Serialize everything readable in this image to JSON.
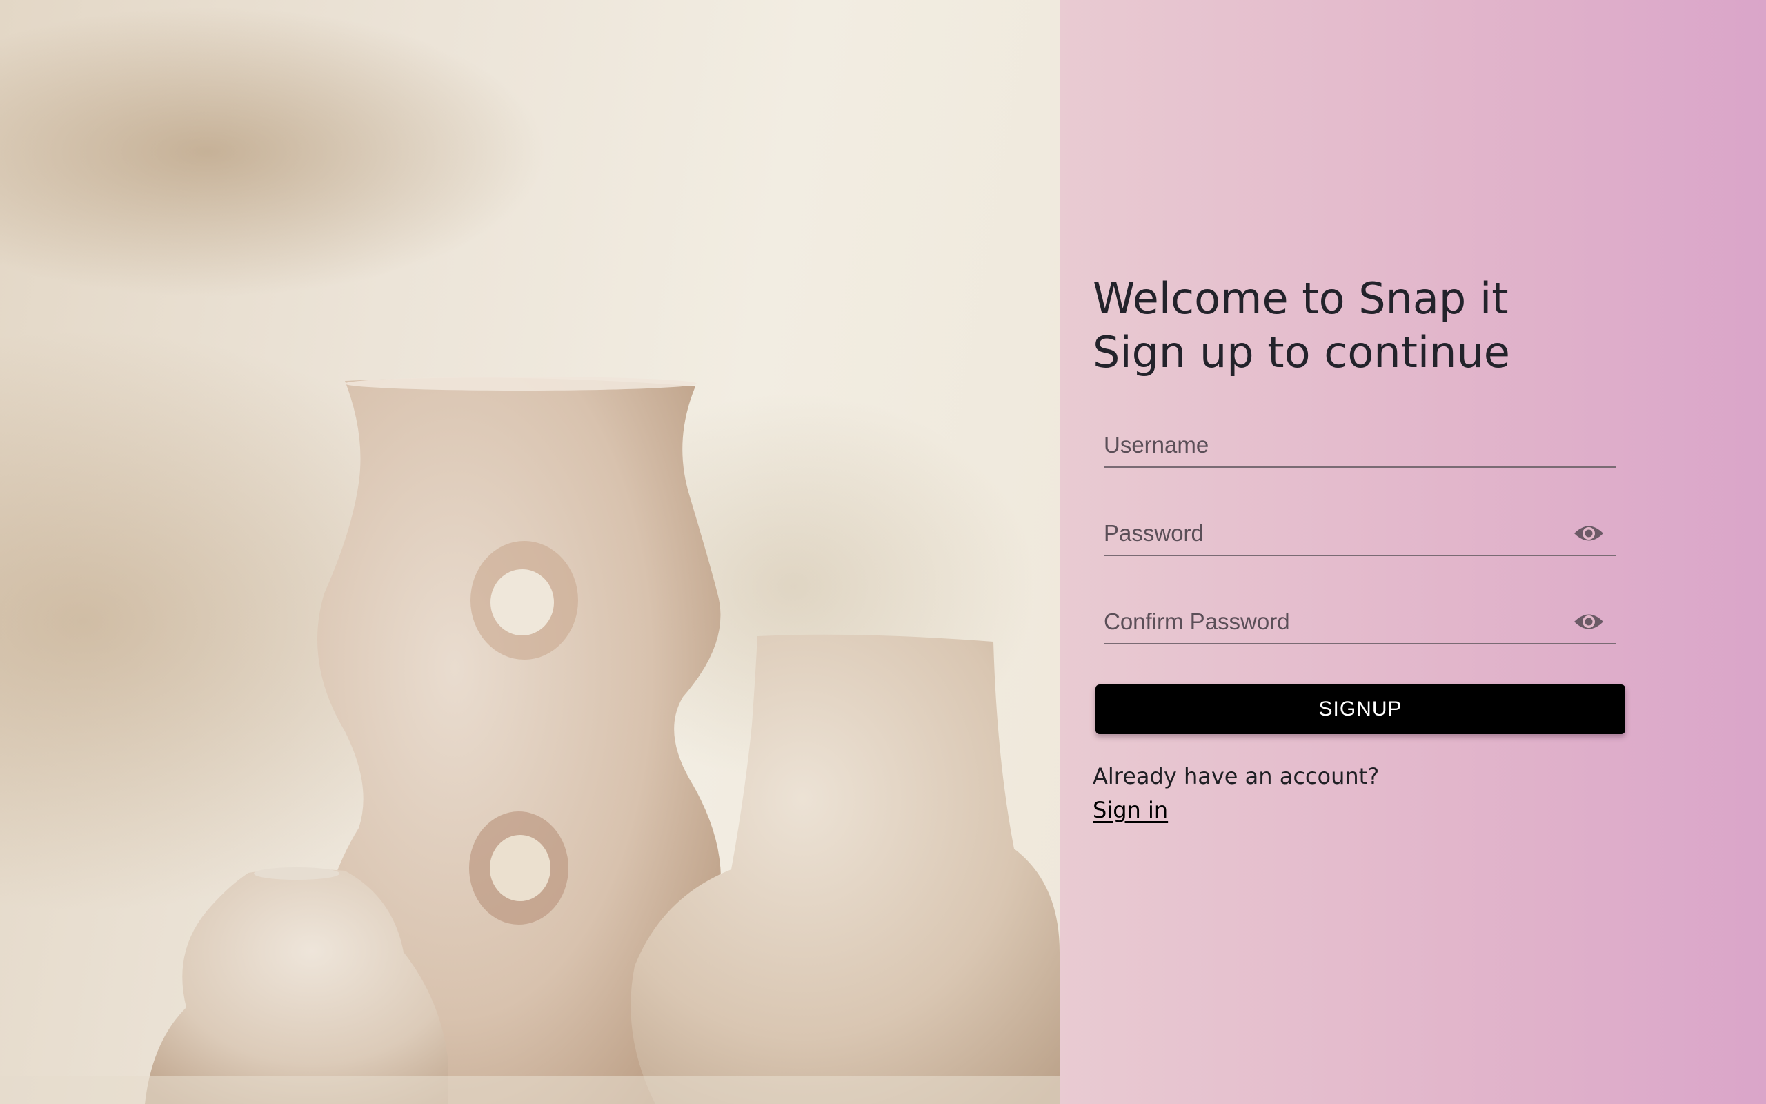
{
  "hero": {
    "image": "ceramic-vases-photo"
  },
  "form": {
    "title_line1": "Welcome to Snap it",
    "title_line2": "Sign up to continue",
    "username": {
      "placeholder": "Username",
      "value": ""
    },
    "password": {
      "placeholder": "Password",
      "value": "",
      "toggle_icon": "eye-icon"
    },
    "confirm_password": {
      "placeholder": "Confirm Password",
      "value": "",
      "toggle_icon": "eye-icon"
    },
    "submit_label": "SIGNUP",
    "existing_account_prompt": "Already have an account?",
    "signin_link": "Sign in"
  },
  "colors": {
    "panel_gradient_start": "#e9cbd2",
    "panel_gradient_end": "#daa5c9",
    "button_bg": "#000000",
    "button_text": "#ffffff",
    "heading_text": "#23232b"
  }
}
